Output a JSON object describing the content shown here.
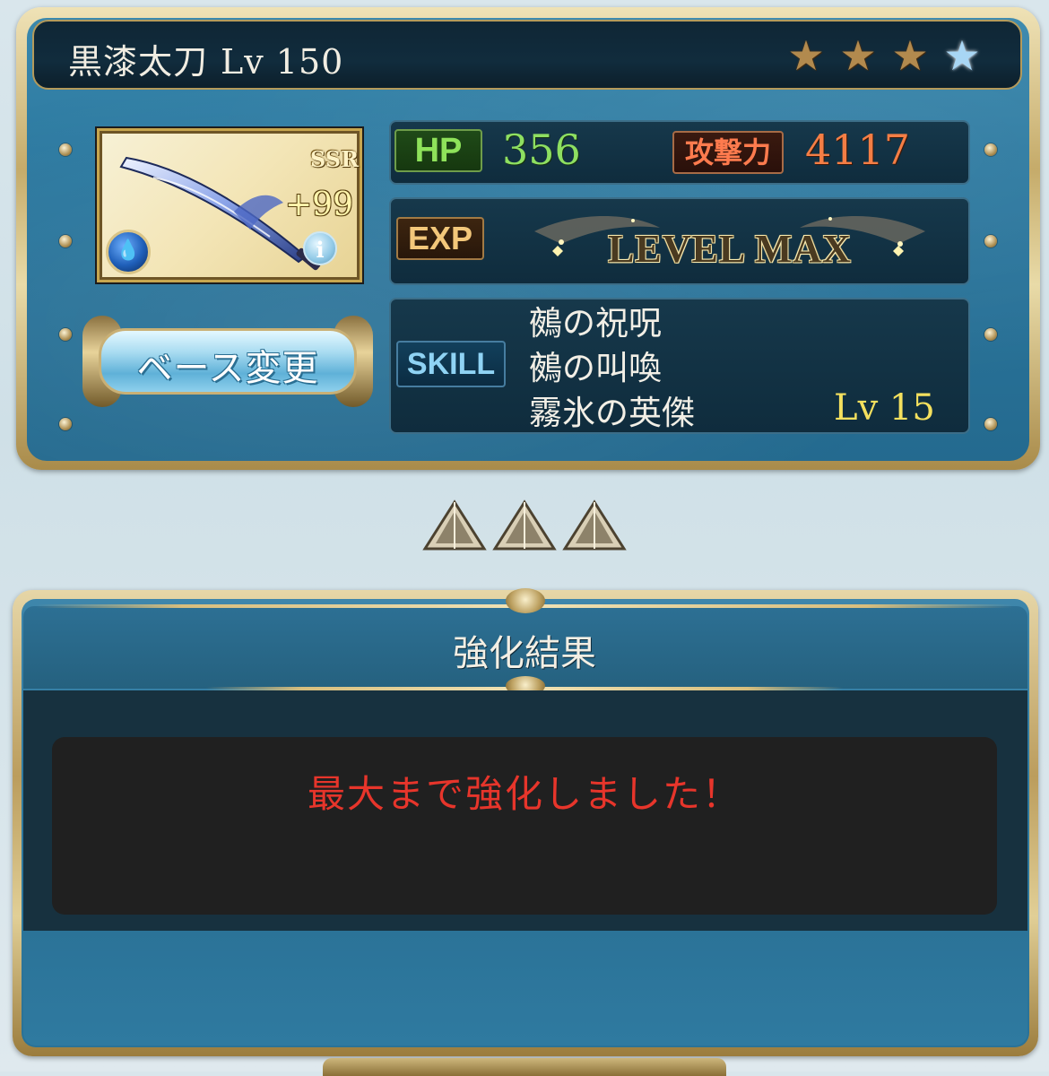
{
  "weapon": {
    "name": "黒漆太刀",
    "level_label": "Lv 150",
    "rarity": "SSR",
    "plus": "+99",
    "stars": 4,
    "info_glyph": "i",
    "element_icon": "water-element-icon"
  },
  "stats": {
    "hp_label": "HP",
    "hp_value": "356",
    "atk_label": "攻撃力",
    "atk_value": "4117",
    "exp_label": "EXP",
    "exp_status": "LEVEL MAX",
    "skill_label": "SKILL",
    "skills": [
      "鵺の祝呪",
      "鵺の叫喚",
      "霧氷の英傑"
    ],
    "skill_level": "Lv 15"
  },
  "buttons": {
    "base_change": "ベース変更"
  },
  "result": {
    "title": "強化結果",
    "message": "最大まで強化しました！"
  },
  "colors": {
    "hp": "#8edf61",
    "atk": "#f47e45",
    "skill_level": "#f4e05e",
    "message": "#e7352b",
    "frame_gold": "#c5ab6a",
    "panel_blue": "#2d7aa1"
  }
}
